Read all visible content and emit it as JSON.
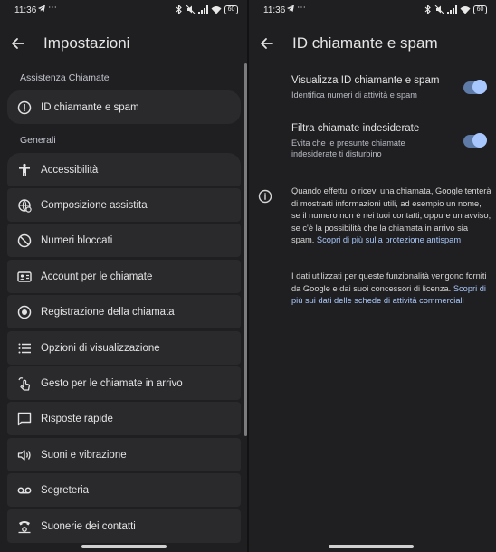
{
  "status_bar": {
    "time": "11:36",
    "battery": "60"
  },
  "left": {
    "title": "Impostazioni",
    "section_calls": "Assistenza Chiamate",
    "caller_id_item": "ID chiamante e spam",
    "section_general": "Generali",
    "general_items": [
      {
        "label": "Accessibilità",
        "icon": "accessibility-icon"
      },
      {
        "label": "Composizione assistita",
        "icon": "assisted-dialing-icon"
      },
      {
        "label": "Numeri bloccati",
        "icon": "block-icon"
      },
      {
        "label": "Account per le chiamate",
        "icon": "calling-account-icon"
      },
      {
        "label": "Registrazione della chiamata",
        "icon": "record-icon"
      },
      {
        "label": "Opzioni di visualizzazione",
        "icon": "list-icon"
      },
      {
        "label": "Gesto per le chiamate in arrivo",
        "icon": "gesture-icon"
      },
      {
        "label": "Risposte rapide",
        "icon": "chat-icon"
      },
      {
        "label": "Suoni e vibrazione",
        "icon": "volume-icon"
      },
      {
        "label": "Segreteria",
        "icon": "voicemail-icon"
      },
      {
        "label": "Suonerie dei contatti",
        "icon": "ringtone-icon"
      }
    ]
  },
  "right": {
    "title": "ID chiamante e spam",
    "toggles": [
      {
        "title": "Visualizza ID chiamante e spam",
        "subtitle": "Identifica numeri di attività e spam",
        "on": true
      },
      {
        "title": "Filtra chiamate indesiderate",
        "subtitle": "Evita che le presunte chiamate indesiderate ti disturbino",
        "on": true
      }
    ],
    "info_text": "Quando effettui o ricevi una chiamata, Google tenterà di mostrarti informazioni utili, ad esempio un nome, se il numero non è nei tuoi contatti, oppure un avviso, se c'è la possibilità che la chiamata in arrivo sia spam.",
    "info_link": "Scopri di più sulla protezione antispam",
    "data_text": "I dati utilizzati per queste funzionalità vengono forniti da Google e dai suoi concessori di licenza.",
    "data_link": "Scopri di più sui dati delle schede di attività commerciali"
  },
  "colors": {
    "background": "#1f1f21",
    "card": "#2a2a2d",
    "accent": "#a9c7ff",
    "link": "#a8c7fa"
  }
}
